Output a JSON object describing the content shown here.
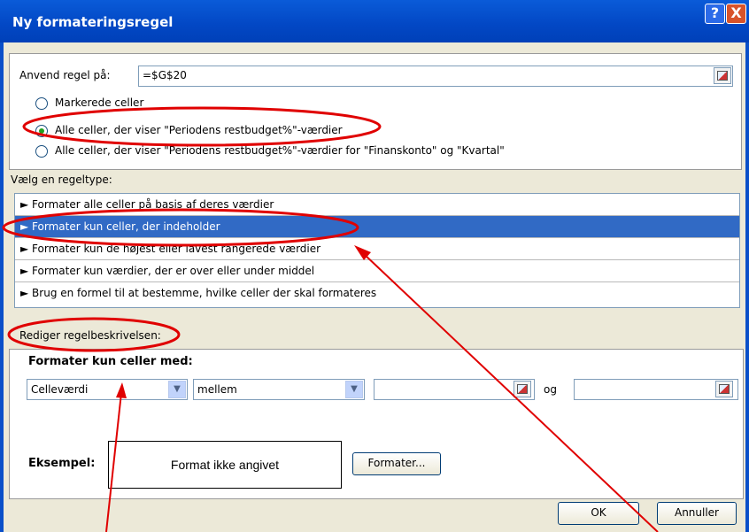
{
  "window": {
    "title": "Ny formateringsregel",
    "help_glyph": "?",
    "close_glyph": "X"
  },
  "apply": {
    "label": "Anvend regel på:",
    "value": "=$G$20"
  },
  "scope_options": [
    {
      "label": "Markerede celler",
      "selected": false
    },
    {
      "label": "Alle celler, der viser \"Periodens restbudget%\"-værdier",
      "selected": true
    },
    {
      "label": "Alle celler, der viser \"Periodens restbudget%\"-værdier for \"Finanskonto\" og \"Kvartal\"",
      "selected": false
    }
  ],
  "rule_type": {
    "label": "Vælg en regeltype:",
    "items": [
      {
        "label": "► Formater alle celler på basis af deres værdier",
        "selected": false
      },
      {
        "label": "► Formater kun celler, der indeholder",
        "selected": true
      },
      {
        "label": "► Formater kun de højest eller lavest rangerede værdier",
        "selected": false
      },
      {
        "label": "► Formater kun værdier, der er over eller under middel",
        "selected": false
      },
      {
        "label": "► Brug en formel til at bestemme, hvilke celler der skal formateres",
        "selected": false
      }
    ]
  },
  "description": {
    "label": "Rediger regelbeskrivelsen:",
    "heading": "Formater kun celler med:",
    "condition_type": "Celleværdi",
    "operator": "mellem",
    "joiner": "og",
    "dropdown_arrow": "▼"
  },
  "preview": {
    "label": "Eksempel:",
    "text": "Format ikke angivet",
    "format_button": "Formater..."
  },
  "buttons": {
    "ok": "OK",
    "cancel": "Annuller"
  },
  "colors": {
    "titlebar": "#0247c4",
    "selection": "#316ac5",
    "annotation": "#e00000"
  }
}
